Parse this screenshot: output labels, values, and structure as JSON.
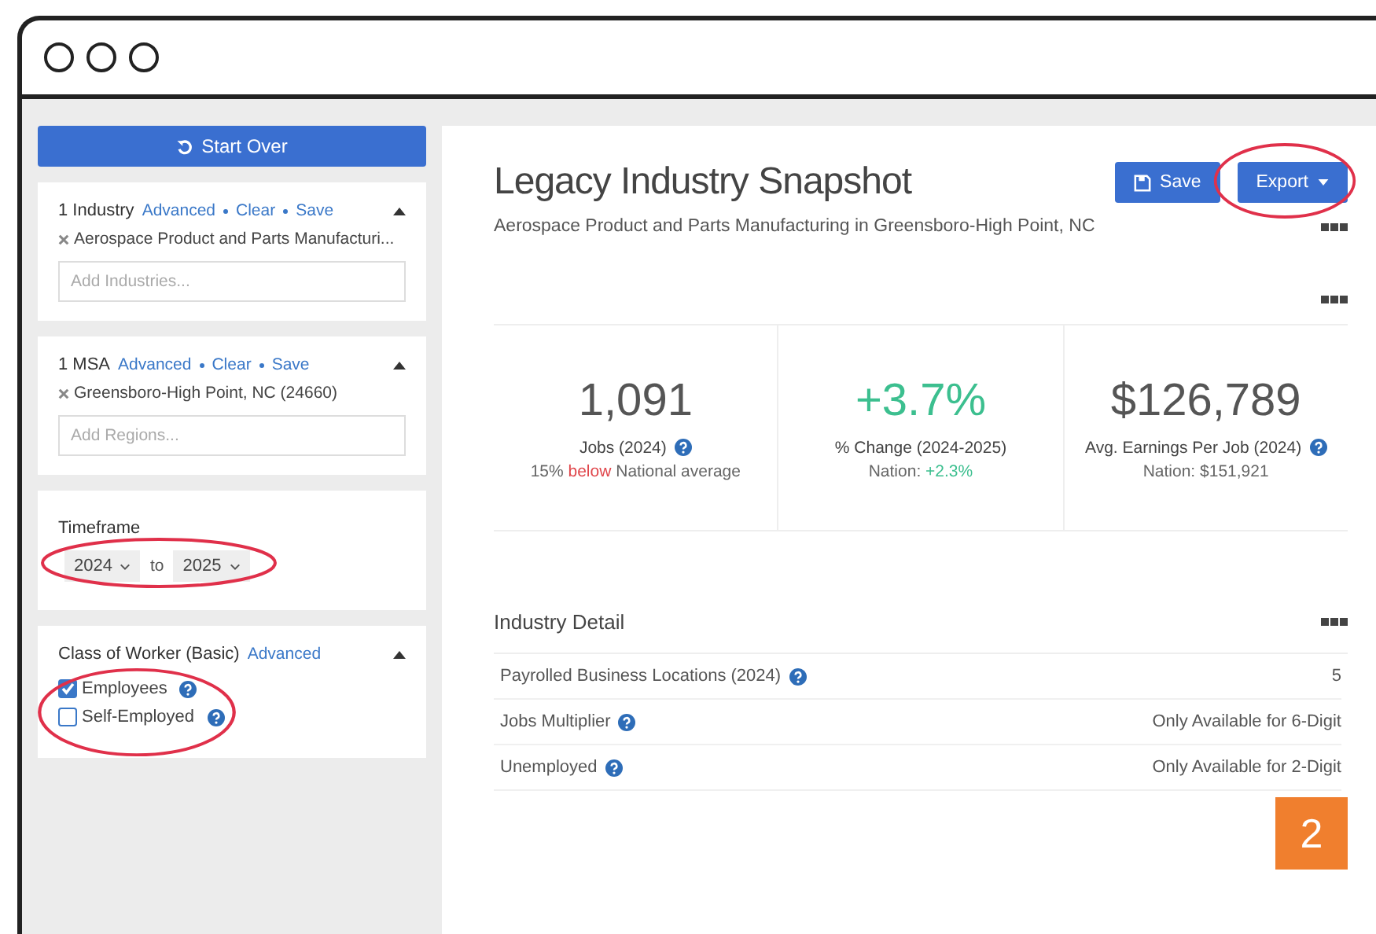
{
  "sidebar": {
    "start_over": "Start Over",
    "panels": [
      {
        "kind": "filter",
        "title": "1 Industry",
        "links": [
          "Advanced",
          "Clear",
          "Save"
        ],
        "expanded": true,
        "selection": "Aerospace Product and Parts Manufacturi...",
        "placeholder": "Add Industries..."
      },
      {
        "kind": "filter",
        "title": "1 MSA",
        "links": [
          "Advanced",
          "Clear",
          "Save"
        ],
        "expanded": true,
        "selection": "Greensboro-High Point, NC (24660)",
        "placeholder": "Add Regions..."
      },
      {
        "kind": "timeframe",
        "title": "Timeframe",
        "from": "2024",
        "separator": "to",
        "to": "2025"
      },
      {
        "kind": "checklist",
        "title": "Class of Worker (Basic)",
        "links": [
          "Advanced"
        ],
        "expanded": true,
        "options": [
          {
            "label": "Employees",
            "checked": true
          },
          {
            "label": "Self-Employed",
            "checked": false
          }
        ]
      }
    ]
  },
  "main": {
    "title": "Legacy Industry Snapshot",
    "subtitle": "Aerospace Product and Parts Manufacturing in Greensboro-High Point, NC",
    "buttons": [
      {
        "kind": "save",
        "label": "Save"
      },
      {
        "kind": "export",
        "label": "Export"
      }
    ],
    "stats": [
      {
        "value": "1,091",
        "positive": false,
        "label": "Jobs (2024)",
        "help": true,
        "note": {
          "before": "15%",
          "highlight": "below",
          "after": "National average",
          "negative": true
        }
      },
      {
        "value": "+3.7%",
        "positive": true,
        "label": "% Change (2024-2025)",
        "help": false,
        "note": {
          "before": "Nation:",
          "highlight": "+2.3%",
          "negative": false
        }
      },
      {
        "value": "$126,789",
        "positive": false,
        "label": "Avg. Earnings Per Job (2024)",
        "help": true,
        "note": {
          "before": "Nation: $151,921"
        }
      }
    ],
    "detail": {
      "title": "Industry Detail",
      "rows": [
        {
          "label": "Payrolled Business Locations (2024)",
          "help": true,
          "value": "5"
        },
        {
          "label": "Jobs Multiplier",
          "help": true,
          "value": "Only Available for 6-Digit"
        },
        {
          "label": "Unemployed",
          "help": true,
          "value": "Only Available for 2-Digit"
        }
      ]
    }
  },
  "step_badge": "2"
}
